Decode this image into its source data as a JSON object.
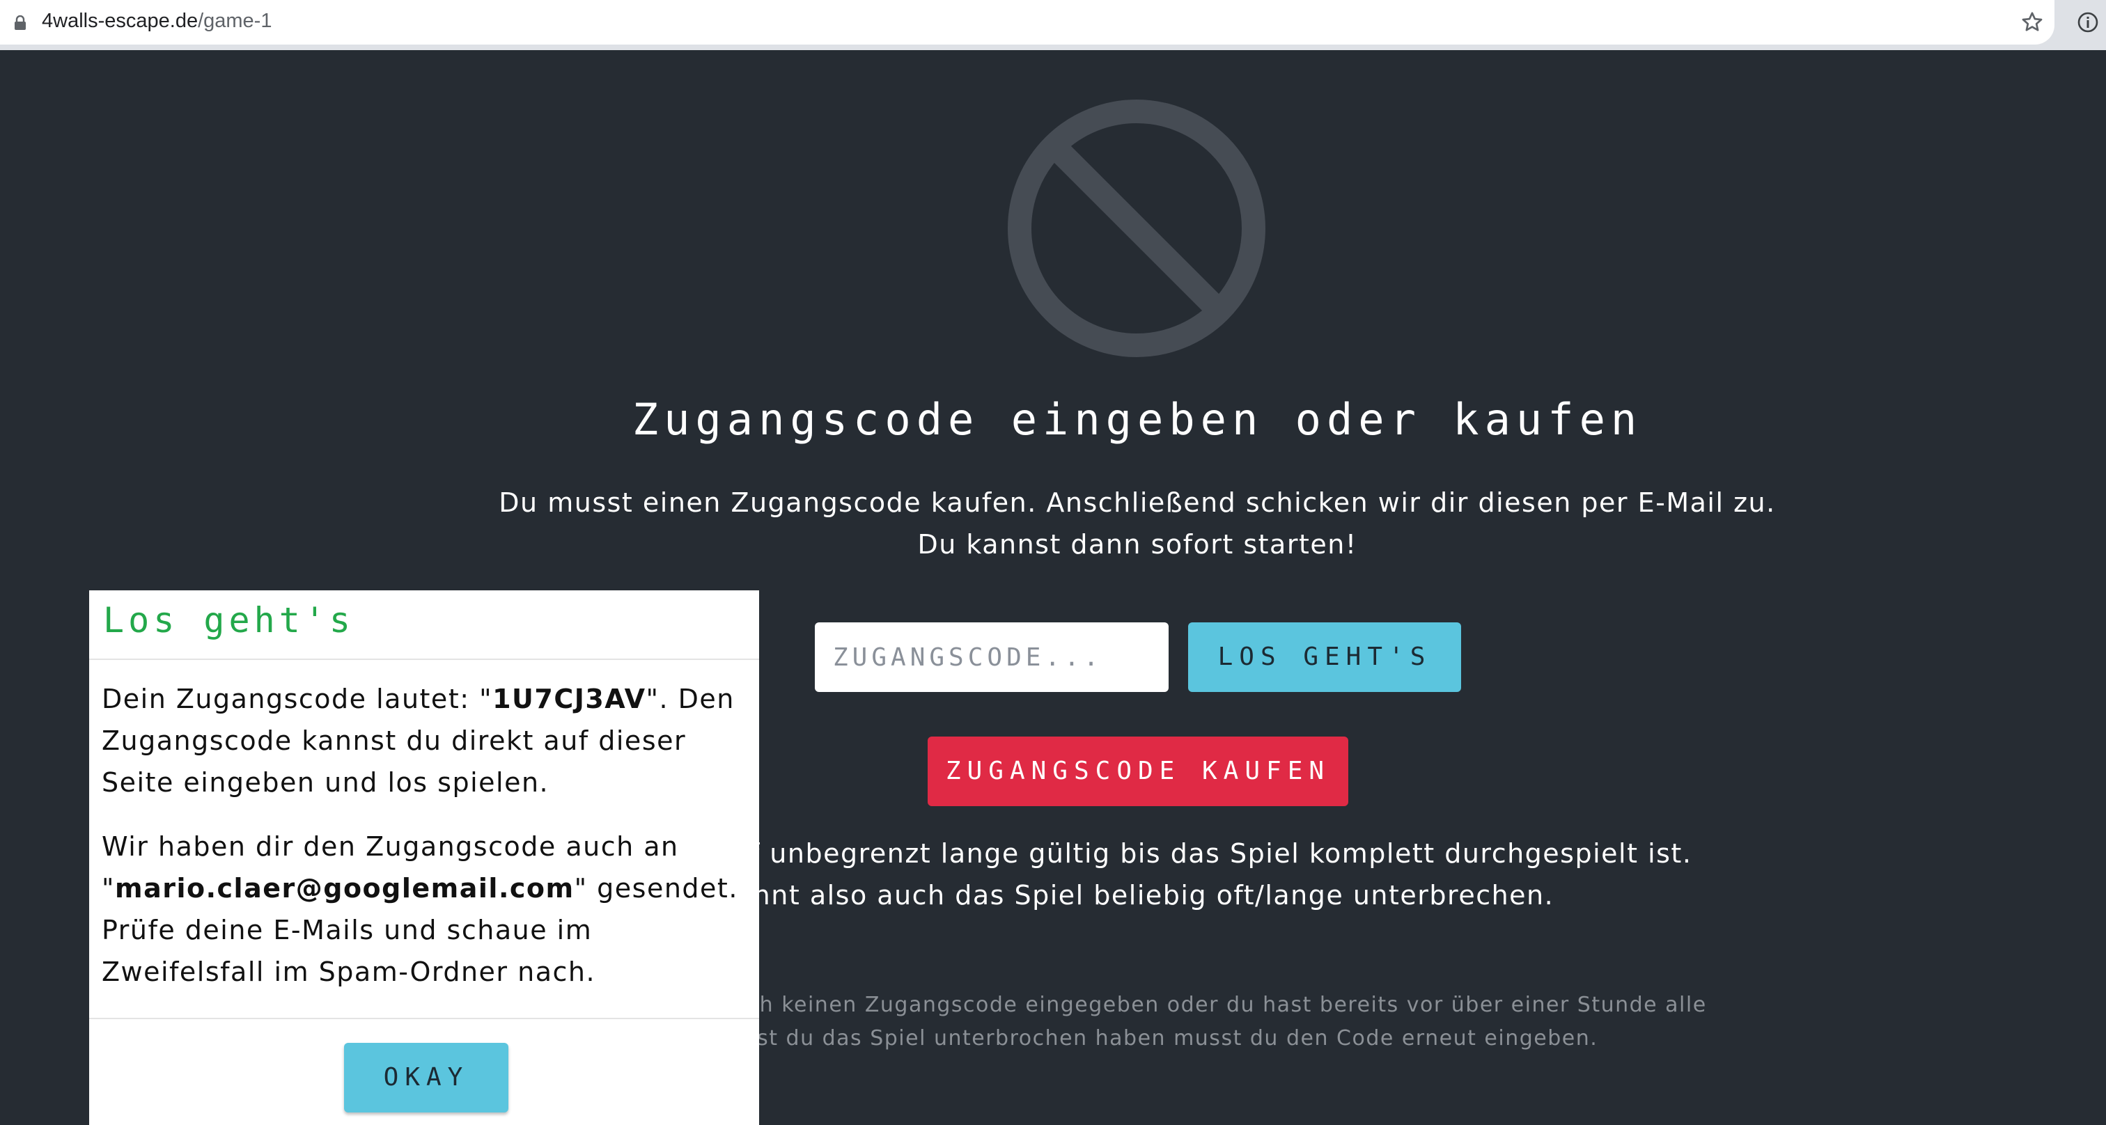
{
  "browser": {
    "url_domain": "4walls-escape.de",
    "url_path": "/game-1",
    "icons": [
      "lock-icon",
      "star-icon",
      "info-icon"
    ]
  },
  "page": {
    "status_icon": "block-icon",
    "title": "Zugangscode eingeben oder kaufen",
    "intro_line1": "Du musst einen Zugangscode kaufen. Anschließend schicken wir dir diesen per E-Mail zu.",
    "intro_line2": "Du kannst dann sofort starten!",
    "code_input": {
      "placeholder": "ZUGANGSCODE...",
      "value": ""
    },
    "go_button": "LOS GEHT'S",
    "buy_button": "ZUGANGSCODE KAUFEN",
    "validity_line1": "ch dem Kauf unbegrenzt lange gültig bis das Spiel komplett durchgespielt ist.",
    "validity_line2": "könnt also auch das Spiel beliebig oft/lange unterbrechen.",
    "footnote_line1": "hen, hast du noch keinen Zugangscode eingegeben oder du hast bereits vor über einer Stunde alle",
    "footnote_line2": ". Solltest du das Spiel unterbrochen haben musst du den Code erneut eingeben."
  },
  "modal": {
    "title": "Los geht's",
    "p1_prefix": "Dein Zugangscode lautet: \"",
    "code": "1U7CJ3AV",
    "p1_suffix": "\". Den Zugangscode kannst du direkt auf dieser Seite eingeben und los spielen.",
    "p2_prefix": "Wir haben dir den Zugangscode auch an \"",
    "email": "mario.claer@googlemail.com",
    "p2_suffix": "\" gesendet. Prüfe deine E-Mails und schaue im Zweifelsfall im Spam-Ordner nach.",
    "okay_button": "OKAY"
  },
  "colors": {
    "background": "#262c33",
    "accent_cyan": "#5bc5de",
    "accent_red": "#e02a45",
    "modal_title_green": "#23a84a"
  }
}
